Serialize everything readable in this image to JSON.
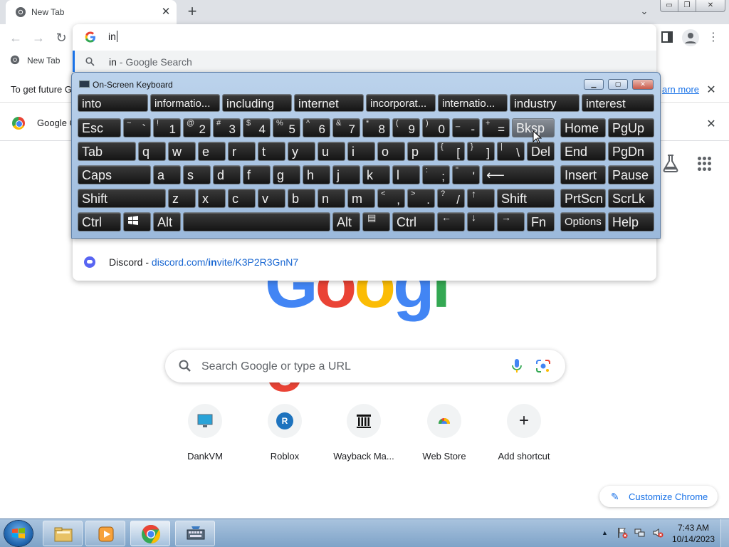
{
  "browser": {
    "tab_title": "New Tab",
    "tab_close": "✕",
    "new_tab": "+",
    "tab_search": "⌄",
    "window_buttons": {
      "minimize": "▭",
      "maximize": "❐",
      "close": "✕"
    },
    "nav": {
      "back": "←",
      "forward": "→",
      "reload": "↻",
      "menu": "⋮"
    },
    "bookmarks": [
      {
        "label": "New Tab"
      }
    ]
  },
  "omnibox": {
    "input_value": "in",
    "suggestions": [
      {
        "typed": "in",
        "rest": " - Google Search",
        "icon": "search-icon"
      },
      {
        "site": "Discord",
        "separator": " - ",
        "url_pre": "discord.com/",
        "url_match": "in",
        "url_post": "vite/K3P2R3GnN7",
        "icon": "discord-icon"
      }
    ]
  },
  "infobars": {
    "first_text": "To get future G",
    "first_link": "arn more",
    "close": "✕",
    "second_text": "Google C",
    "second_close": "✕"
  },
  "page": {
    "logo": [
      "G",
      "o",
      "o",
      "g",
      "l",
      "e"
    ],
    "logo_colors": [
      "#4285f4",
      "#ea4335",
      "#fbbc04",
      "#4285f4",
      "#34a853",
      "#ea4335"
    ],
    "search_placeholder": "Search Google or type a URL",
    "shortcuts": [
      {
        "label": "DankVM",
        "icon": "monitor-icon"
      },
      {
        "label": "Roblox",
        "icon": "roblox-icon",
        "glyph": "R"
      },
      {
        "label": "Wayback Ma...",
        "icon": "wayback-icon"
      },
      {
        "label": "Web Store",
        "icon": "web-store-icon"
      },
      {
        "label": "Add shortcut",
        "icon": "plus-icon",
        "glyph": "+"
      }
    ],
    "customize_label": "Customize Chrome",
    "customize_icon": "✎"
  },
  "osk": {
    "title": "On-Screen Keyboard",
    "window_buttons": {
      "minimize": "▁",
      "maximize": "▢",
      "close": "✕"
    },
    "predictions": [
      "into",
      "informatio...",
      "including",
      "internet",
      "incorporat...",
      "internatio...",
      "industry",
      "interest"
    ],
    "row1": {
      "esc": "Esc",
      "symbols": [
        {
          "s": "~",
          "l": "`"
        },
        {
          "s": "!",
          "l": "1"
        },
        {
          "s": "@",
          "l": "2"
        },
        {
          "s": "#",
          "l": "3"
        },
        {
          "s": "$",
          "l": "4"
        },
        {
          "s": "%",
          "l": "5"
        },
        {
          "s": "^",
          "l": "6"
        },
        {
          "s": "&",
          "l": "7"
        },
        {
          "s": "*",
          "l": "8"
        },
        {
          "s": "(",
          "l": "9"
        },
        {
          "s": ")",
          "l": "0"
        },
        {
          "s": "_",
          "l": "-"
        },
        {
          "s": "+",
          "l": "="
        }
      ],
      "bksp": "Bksp",
      "home": "Home",
      "pgup": "PgUp"
    },
    "row2": {
      "tab": "Tab",
      "letters": [
        "q",
        "w",
        "e",
        "r",
        "t",
        "y",
        "u",
        "i",
        "o",
        "p"
      ],
      "symbols": [
        {
          "s": "{",
          "l": "["
        },
        {
          "s": "}",
          "l": "]"
        },
        {
          "s": "|",
          "l": "\\"
        }
      ],
      "del": "Del",
      "end": "End",
      "pgdn": "PgDn"
    },
    "row3": {
      "caps": "Caps",
      "letters": [
        "a",
        "s",
        "d",
        "f",
        "g",
        "h",
        "j",
        "k",
        "l"
      ],
      "symbols": [
        {
          "s": ":",
          "l": ";"
        },
        {
          "s": "\"",
          "l": "'"
        }
      ],
      "enter": "⟵",
      "insert": "Insert",
      "pause": "Pause"
    },
    "row4": {
      "shift_left": "Shift",
      "letters": [
        "z",
        "x",
        "c",
        "v",
        "b",
        "n",
        "m"
      ],
      "symbols": [
        {
          "s": "<",
          "l": ","
        },
        {
          "s": ">",
          "l": "."
        },
        {
          "s": "?",
          "l": "/"
        }
      ],
      "up": "↑",
      "shift_right": "Shift",
      "prtscn": "PrtScn",
      "scrlk": "ScrLk"
    },
    "row5": {
      "ctrl_left": "Ctrl",
      "alt_left": "Alt",
      "alt_right": "Alt",
      "menu": "▤",
      "ctrl_right": "Ctrl",
      "left": "←",
      "down": "↓",
      "right": "→",
      "fn": "Fn",
      "options": "Options",
      "help": "Help"
    }
  },
  "taskbar": {
    "time": "7:43 AM",
    "date": "10/14/2023",
    "tray_arrow": "▲"
  },
  "colors": {
    "accent": "#1a73e8",
    "osk_frame": "#a9c3e0",
    "osk_key": "#1f1f1f",
    "taskbar": "#8fb0d4"
  }
}
